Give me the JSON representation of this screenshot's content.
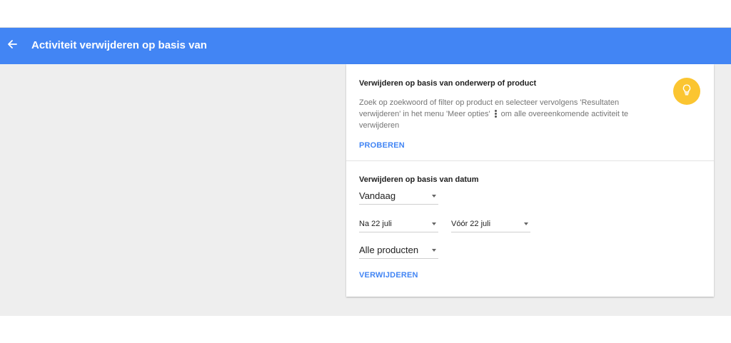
{
  "header": {
    "title": "Activiteit verwijderen op basis van",
    "back_icon": "arrow-back-icon",
    "color": "#4285f4"
  },
  "product_section": {
    "title": "Verwijderen op basis van onderwerp of product",
    "description_part1": "Zoek op zoekwoord of filter op product en selecteer vervolgens 'Resultaten verwijderen' in het menu 'Meer opties'",
    "description_part2": "om alle overeenkomende activiteit te verwijderen",
    "inline_icon": "more-vert-icon",
    "tip_icon": "lightbulb-icon",
    "tip_color": "#fbc531",
    "action_label": "PROBEREN"
  },
  "date_section": {
    "title": "Verwijderen op basis van datum",
    "range_select": "Vandaag",
    "after_select": "Na 22 juli",
    "before_select": "Vóór 22 juli",
    "product_select": "Alle producten",
    "action_label": "VERWIJDEREN"
  }
}
